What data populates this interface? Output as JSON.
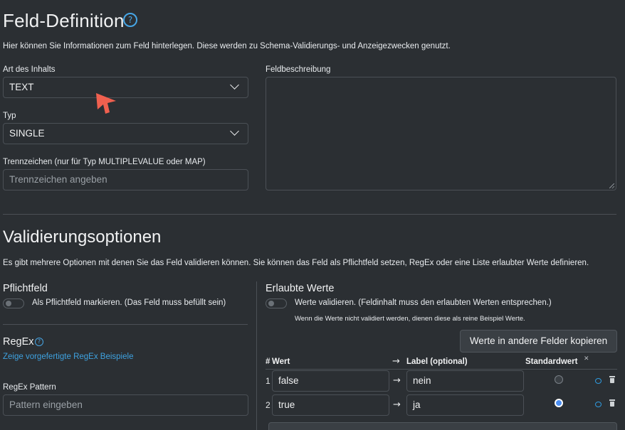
{
  "field_definition": {
    "title": "Feld-Definition",
    "help_icon": "?",
    "description": "Hier können Sie Informationen zum Feld hinterlegen. Diese werden zu Schema-Validierungs- und Anzeigezwecken genutzt.",
    "content_type_label": "Art des Inhalts",
    "content_type_value": "TEXT",
    "type_label": "Typ",
    "type_value": "SINGLE",
    "separator_label": "Trennzeichen (nur für Typ MULTIPLEVALUE oder MAP)",
    "separator_placeholder": "Trennzeichen angeben",
    "field_description_label": "Feldbeschreibung"
  },
  "validation": {
    "title": "Validierungsoptionen",
    "description": "Es gibt mehrere Optionen mit denen Sie das Feld validieren können. Sie können das Feld als Pflichtfeld setzen, RegEx oder eine Liste erlaubter Werte definieren.",
    "required_heading": "Pflichtfeld",
    "required_toggle_label": "Als Pflichtfeld markieren. (Das Feld muss befüllt sein)",
    "regex_heading": "RegEx",
    "regex_examples_link": "Zeige vorgefertigte RegEx Beispiele",
    "regex_pattern_label": "RegEx Pattern",
    "regex_pattern_placeholder": "Pattern eingeben",
    "allowed_heading": "Erlaubte Werte",
    "validate_values_label": "Werte validieren. (Feldinhalt muss den erlaubten Werten entsprechen.)",
    "validate_values_note": "Wenn die Werte nicht validiert werden, dienen diese als reine Beispiel Werte.",
    "copy_button": "Werte in andere Felder kopieren",
    "table": {
      "col_hash": "#",
      "col_value": "Wert",
      "col_arrow": "→",
      "col_label": "Label (optional)",
      "col_default": "Standardwert",
      "col_default_clear": "✕",
      "rows": [
        {
          "num": "1",
          "value": "false",
          "arrow": "→",
          "label": "nein",
          "default": false
        },
        {
          "num": "2",
          "value": "true",
          "arrow": "→",
          "label": "ja",
          "default": true
        }
      ]
    }
  },
  "colors": {
    "background": "#2b2f33",
    "accent": "#47a6e6",
    "link": "#3ea2e0",
    "radio_selected": "#4b8ef2",
    "cursor": "#f0604f"
  }
}
